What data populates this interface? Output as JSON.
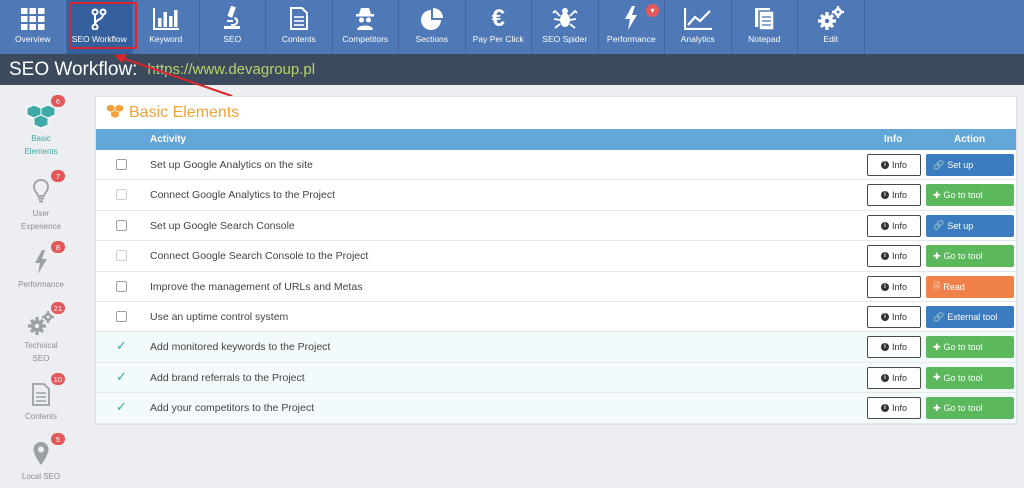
{
  "nav": {
    "items": [
      {
        "label": "Overview",
        "icon": "grid-icon"
      },
      {
        "label": "SEO Workflow",
        "icon": "branch-icon"
      },
      {
        "label": "Keyword",
        "icon": "bar-chart-icon"
      },
      {
        "label": "SEO",
        "icon": "microscope-icon"
      },
      {
        "label": "Contents",
        "icon": "document-icon"
      },
      {
        "label": "Competitors",
        "icon": "spy-icon"
      },
      {
        "label": "Sections",
        "icon": "pie-chart-icon"
      },
      {
        "label": "Pay Per Click",
        "icon": "euro-icon"
      },
      {
        "label": "SEO Spider",
        "icon": "spider-icon"
      },
      {
        "label": "Performance",
        "icon": "bolt-icon"
      },
      {
        "label": "Analytics",
        "icon": "line-chart-icon"
      },
      {
        "label": "Notepad",
        "icon": "notepad-icon"
      },
      {
        "label": "Edit",
        "icon": "gears-icon"
      }
    ],
    "active": "SEO Workflow",
    "performance_badge": "▾"
  },
  "title": {
    "label": "SEO Workflow:",
    "url": "https://www.devagroup.pl"
  },
  "sidebar": {
    "items": [
      {
        "label1": "Basic",
        "label2": "Elements",
        "badge": "6",
        "icon": "cubes-icon"
      },
      {
        "label1": "User",
        "label2": "Experience",
        "badge": "7",
        "icon": "lightbulb-icon"
      },
      {
        "label1": "Performance",
        "label2": "",
        "badge": "8",
        "icon": "bolt-icon"
      },
      {
        "label1": "Technical",
        "label2": "SEO",
        "badge": "21",
        "icon": "gears-icon"
      },
      {
        "label1": "Contents",
        "label2": "",
        "badge": "10",
        "icon": "document-icon"
      },
      {
        "label1": "Local SEO",
        "label2": "",
        "badge": "5",
        "icon": "map-pin-icon"
      }
    ]
  },
  "panel": {
    "title": "Basic Elements",
    "headers": {
      "activity": "Activity",
      "info": "Info",
      "action": "Action"
    },
    "info_label": "Info",
    "rows": [
      {
        "activity": "Set up Google Analytics on the site",
        "done": false,
        "dim": false,
        "action": "Set up",
        "action_type": "blue",
        "action_icon": "link-icon"
      },
      {
        "activity": "Connect Google Analytics to the Project",
        "done": false,
        "dim": true,
        "action": "Go to tool",
        "action_type": "green",
        "action_icon": "plus-circle-icon"
      },
      {
        "activity": "Set up Google Search Console",
        "done": false,
        "dim": false,
        "action": "Set up",
        "action_type": "blue",
        "action_icon": "link-icon"
      },
      {
        "activity": "Connect Google Search Console to the Project",
        "done": false,
        "dim": true,
        "action": "Go to tool",
        "action_type": "green",
        "action_icon": "plus-circle-icon"
      },
      {
        "activity": "Improve the management of URLs and Metas",
        "done": false,
        "dim": false,
        "action": "Read",
        "action_type": "orange",
        "action_icon": "file-icon"
      },
      {
        "activity": "Use an uptime control system",
        "done": false,
        "dim": false,
        "action": "External tool",
        "action_type": "blue",
        "action_icon": "link-icon"
      },
      {
        "activity": "Add monitored keywords to the Project",
        "done": true,
        "dim": false,
        "action": "Go to tool",
        "action_type": "green",
        "action_icon": "plus-circle-icon"
      },
      {
        "activity": "Add brand referrals to the Project",
        "done": true,
        "dim": false,
        "action": "Go to tool",
        "action_type": "green",
        "action_icon": "plus-circle-icon"
      },
      {
        "activity": "Add your competitors to the Project",
        "done": true,
        "dim": false,
        "action": "Go to tool",
        "action_type": "green",
        "action_icon": "plus-circle-icon"
      }
    ]
  },
  "colors": {
    "nav_bg": "#4e78b6",
    "title_bg": "#3c4a5e",
    "url": "#b9d466",
    "accent_orange": "#f0a13a",
    "teal": "#3fa9a7",
    "badge_red": "#e4585a"
  }
}
